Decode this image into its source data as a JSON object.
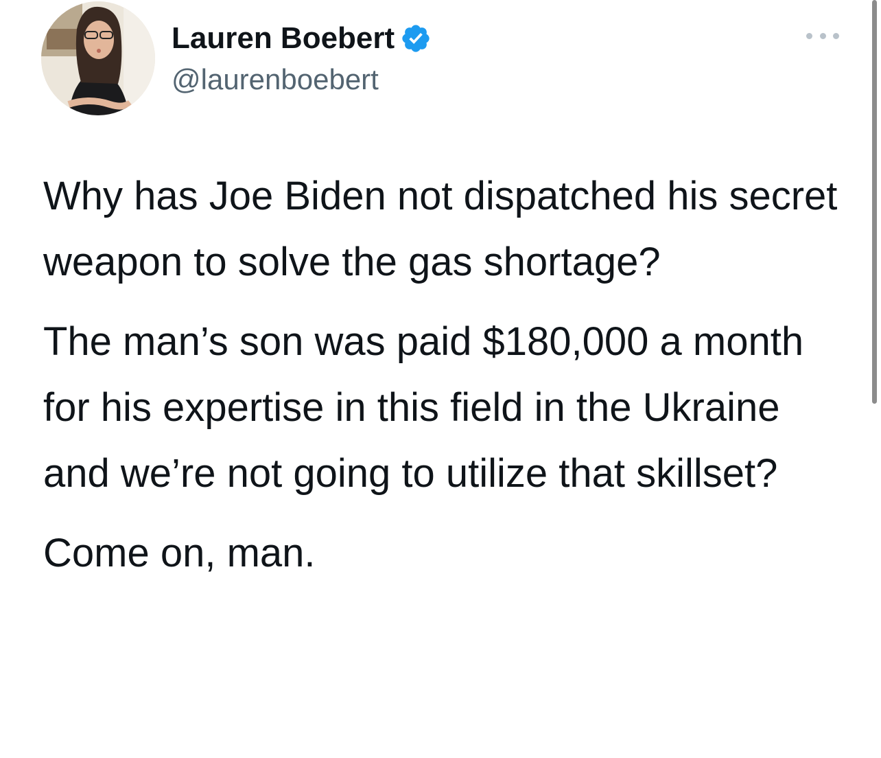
{
  "tweet": {
    "author": {
      "display_name": "Lauren Boebert",
      "handle": "@laurenboebert",
      "verified": true,
      "avatar_icon": "profile-photo"
    },
    "more_icon": "ellipsis-icon",
    "paragraphs": [
      "Why has Joe Biden not dispatched his secret weapon to solve the gas shortage?",
      "The man’s son was paid $180,000 a month for his expertise in this field in the Ukraine and we’re not going to utilize that skillset?",
      "Come on, man."
    ]
  },
  "colors": {
    "text_primary": "#0f1419",
    "text_secondary": "#536471",
    "verified_blue": "#1d9bf0",
    "background": "#ffffff"
  }
}
